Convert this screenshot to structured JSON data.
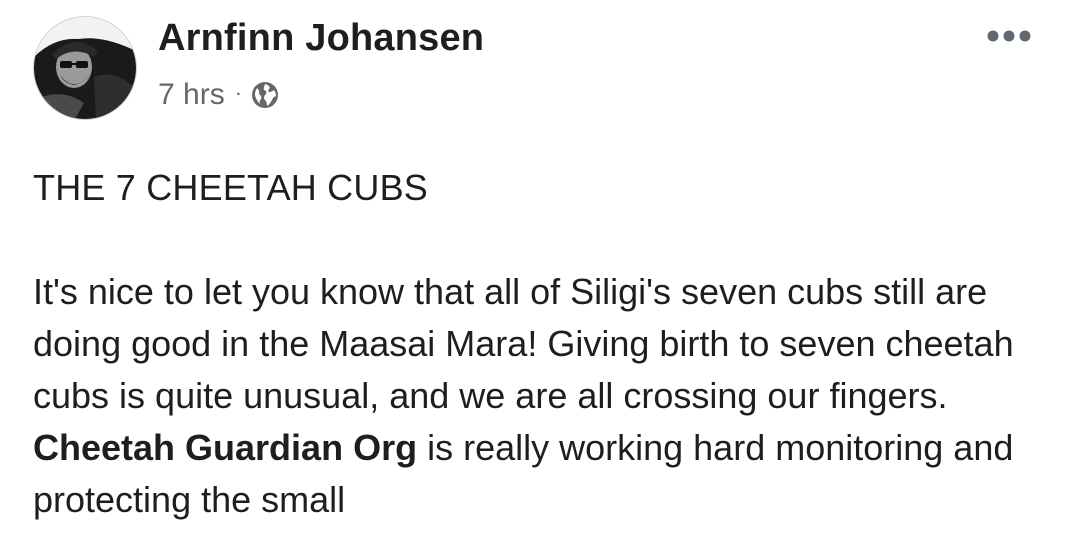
{
  "post": {
    "author": "Arnfinn Johansen",
    "time": "7 hrs",
    "separator": "·",
    "privacy_icon": "globe-icon",
    "more_icon": "more-options-icon",
    "title": "THE 7 CHEETAH CUBS",
    "body_before_link": "It's nice to let you know that all of Siligi's seven cubs still are doing good in the Maasai Mara! Giving birth to seven cheetah cubs is quite unusual, and we are all crossing our fingers. ",
    "link_text": "Cheetah Guardian Org",
    "body_after_link": " is really working hard monitoring and protecting the small"
  },
  "colors": {
    "text": "#1c1e21",
    "secondary_text": "#65676b",
    "background": "#ffffff"
  }
}
